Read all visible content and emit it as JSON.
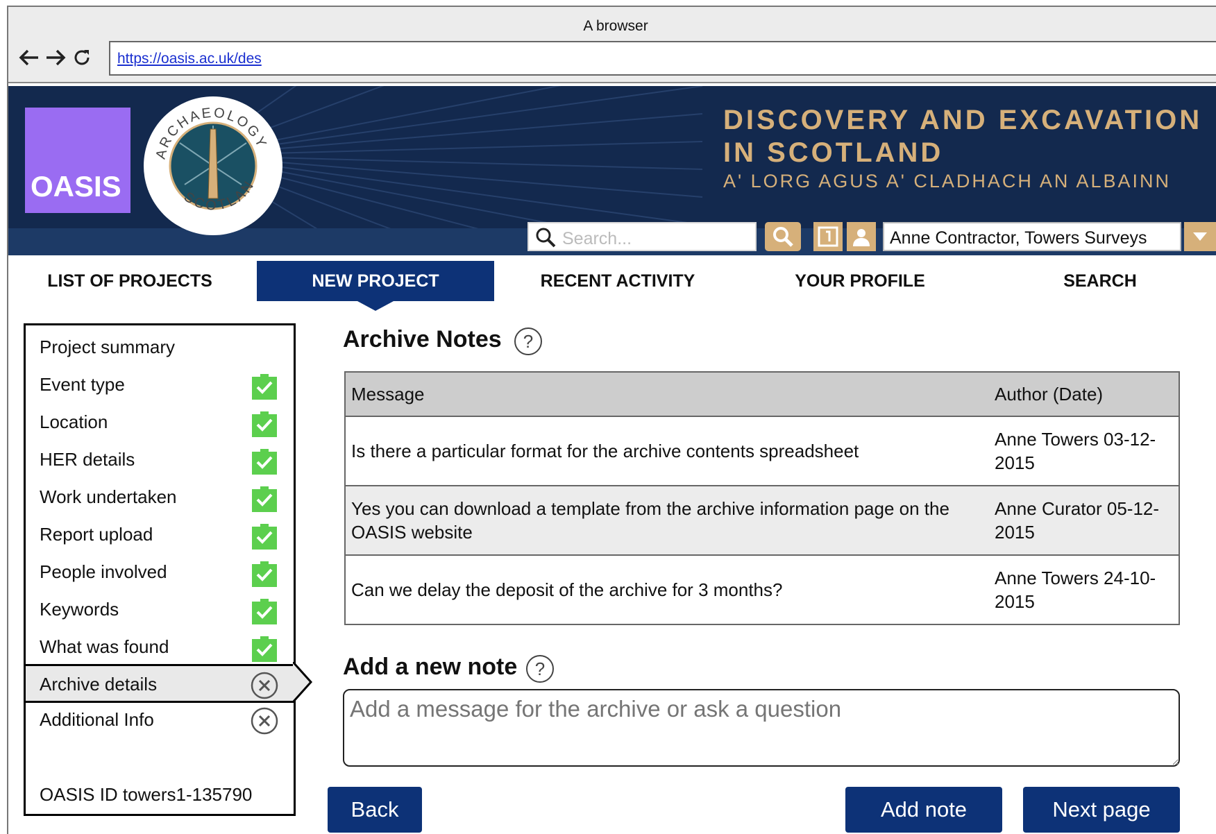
{
  "browser": {
    "title": "A browser",
    "url": "https://oasis.ac.uk/des"
  },
  "banner": {
    "logo_text": "OASIS",
    "seal_text_top": "ARCHAEOLOGY",
    "seal_text_bottom": "SCOTLAND",
    "title_line1": "DISCOVERY AND EXCAVATION",
    "title_line2": "IN SCOTLAND",
    "subtitle": "A' LORG AGUS A' CLADHACH AN ALBAINN",
    "search_placeholder": "Search...",
    "user_label": "Anne Contractor, Towers Surveys",
    "accent_color": "#d6b07a",
    "banner_color": "#13294e"
  },
  "tabs": [
    {
      "label": "LIST OF PROJECTS",
      "active": false
    },
    {
      "label": "NEW PROJECT",
      "active": true
    },
    {
      "label": "RECENT ACTIVITY",
      "active": false
    },
    {
      "label": "YOUR PROFILE",
      "active": false
    },
    {
      "label": "SEARCH",
      "active": false
    }
  ],
  "sidebar": {
    "items": [
      {
        "label": "Project summary",
        "status": "none"
      },
      {
        "label": "Event type",
        "status": "complete"
      },
      {
        "label": "Location",
        "status": "complete"
      },
      {
        "label": "HER details",
        "status": "complete"
      },
      {
        "label": "Work undertaken",
        "status": "complete"
      },
      {
        "label": "Report upload",
        "status": "complete"
      },
      {
        "label": "People involved",
        "status": "complete"
      },
      {
        "label": "Keywords",
        "status": "complete"
      },
      {
        "label": "What was found",
        "status": "complete"
      },
      {
        "label": "Archive details",
        "status": "incomplete",
        "current": true
      },
      {
        "label": "Additional Info",
        "status": "incomplete"
      }
    ],
    "oasis_id": "OASIS ID towers1-135790"
  },
  "archive_notes": {
    "title": "Archive Notes",
    "columns": [
      "Message",
      "Author (Date)"
    ],
    "rows": [
      {
        "message": "Is there a particular format for the archive contents spreadsheet",
        "author": "Anne Towers 03-12-2015"
      },
      {
        "message": "Yes you can download a template from the archive information page on the OASIS website",
        "author": "Anne Curator 05-12-2015"
      },
      {
        "message": "Can we delay the deposit of the archive for 3 months?",
        "author": "Anne Towers 24-10-2015"
      }
    ]
  },
  "new_note": {
    "title": "Add a new note",
    "placeholder": "Add a message for the archive or ask a question"
  },
  "buttons": {
    "back": "Back",
    "add_note": "Add note",
    "next_page": "Next page"
  },
  "colors": {
    "primary": "#0d3277",
    "complete": "#5ccf4e",
    "logo": "#9a6cf2"
  }
}
